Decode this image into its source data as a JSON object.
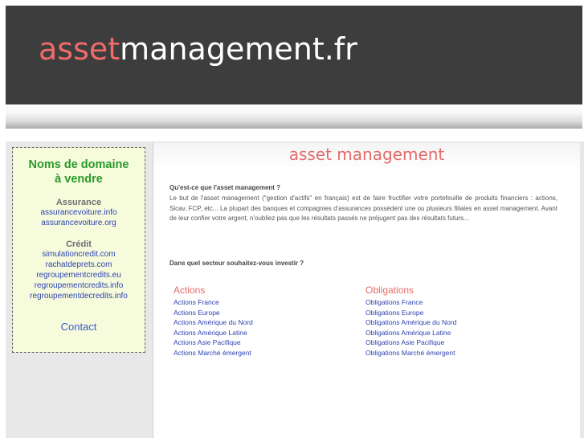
{
  "header": {
    "logo_accent": "asset",
    "logo_rest": "management.fr",
    "background": "#3d3d3d",
    "accent_color": "#f06a6a"
  },
  "sidebar": {
    "title_line1": "Noms de domaine",
    "title_line2": "à vendre",
    "sections": [
      {
        "heading": "Assurance",
        "links": [
          "assurancevoiture.info",
          "assurancevoiture.org"
        ]
      },
      {
        "heading": "Crédit",
        "links": [
          "simulationcredit.com",
          "rachatdeprets.com",
          "regroupementcredits.eu",
          "regroupementcredits.info",
          "regroupementdecredits.info"
        ]
      }
    ],
    "contact": "Contact"
  },
  "main": {
    "title": "asset management",
    "question": "Qu'est-ce que l'asset management ?",
    "paragraph": "Le but de l'asset management (\"gestion d'actifs\" en français) est de faire fructifier votre portefeuille de produits financiers : actions, Sicav, FCP, etc... La plupart des banques et compagnies d'assurances possèdent une ou plusieurs filiales en asset management. Avant de leur confier votre argent, n'oubliez pas que les résultats passés ne préjugent pas des résultats futurs...",
    "question2": "Dans quel secteur souhaitez-vous investir ?",
    "columns": [
      {
        "heading": "Actions",
        "links": [
          "Actions France",
          "Actions Europe",
          "Actions Amérique du Nord",
          "Actions Amérique Latine",
          "Actions Asie Pacifique",
          "Actions Marché émergent"
        ]
      },
      {
        "heading": "Obligations",
        "links": [
          "Obligations France",
          "Obligations Europe",
          "Obligations Amérique du Nord",
          "Obligations Amérique Latine",
          "Obligations Asie Pacifique",
          "Obligations Marché émergent"
        ]
      }
    ]
  }
}
